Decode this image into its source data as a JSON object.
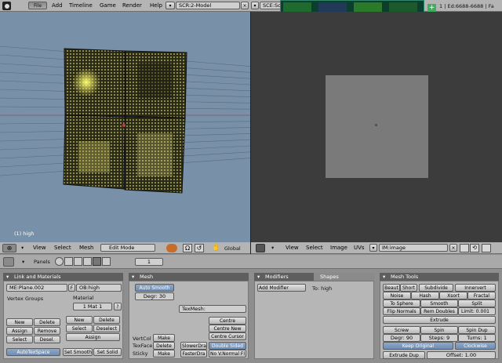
{
  "info_header": {
    "menu": [
      "File",
      "Add",
      "Timeline",
      "Game",
      "Render",
      "Help"
    ],
    "screen": "SCR:2-Model",
    "scene": "SCE:Sc",
    "stats": "1 | Ed:6688-6688 | Fa"
  },
  "viewport3d": {
    "status": "(1) high",
    "header": {
      "view": "View",
      "select": "Select",
      "mesh": "Mesh",
      "mode": "Edit Mode",
      "orientation": "Global"
    }
  },
  "uv_editor": {
    "header": {
      "view": "View",
      "select": "Select",
      "image": "Image",
      "uvs": "UVs",
      "image_name": "IM:image"
    }
  },
  "buttons_header": {
    "panels": "Panels",
    "frame": "1"
  },
  "link_materials": {
    "title": "Link and Materials",
    "mesh_name": "ME:Plane.002",
    "f": "F",
    "ob_name": "OB:high",
    "vertex_groups": "Vertex Groups",
    "material": "Material",
    "mat_slot": "1 Mat 1",
    "question": "?",
    "vg_buttons": [
      "New",
      "Delete",
      "Assign",
      "Remove",
      "Select",
      "Desel."
    ],
    "mat_buttons": [
      "New",
      "Delete",
      "Select",
      "Deselect",
      "Assign"
    ],
    "autotexspace": "AutoTexSpace",
    "set_smooth": "Set Smooth",
    "set_solid": "Set Solid"
  },
  "mesh_panel": {
    "title": "Mesh",
    "auto_smooth": "Auto Smooth",
    "degr": "Degr: 30",
    "texmesh": "TexMesh:",
    "centre": "Centre",
    "centre_new": "Centre New",
    "centre_cursor": "Centre Cursor",
    "vertcol": "VertCol",
    "texface": "TexFace",
    "sticky": "Sticky",
    "make1": "Make",
    "delete": "Delete",
    "make2": "Make",
    "slower": "SlowerDra",
    "faster": "FasterDra",
    "double_sided": "Double Sided",
    "no_v_normal": "No V.Normal Fl"
  },
  "modifiers_panel": {
    "tab1": "Modifiers",
    "tab2": "Shapes",
    "add_modifier": "Add Modifier",
    "to": "To: high"
  },
  "mesh_tools": {
    "title": "Mesh Tools",
    "row1": [
      "Beaut",
      "Short",
      "Subdivide",
      "Innervert"
    ],
    "row2": [
      "Noise",
      "Hash",
      "Xsort",
      "Fractal"
    ],
    "row3": [
      "To Sphere",
      "Smooth",
      "Split"
    ],
    "row4": [
      "Flip Normals",
      "Rem Doubles",
      "Limit: 0.001"
    ],
    "extrude": "Extrude",
    "row5": [
      "Screw",
      "Spin",
      "Spin Dup"
    ],
    "row6": [
      "Degr: 90",
      "Steps: 9",
      "Turns: 1"
    ],
    "keep_original": "Keep Original",
    "clockwise": "Clockwise",
    "extrude_dup": "Extrude Dup",
    "offset": "Offset: 1.00"
  },
  "colors": {
    "viewport_bg": "#7890a8",
    "uv_bg": "#3c3c3c",
    "image_fill": "#7a7a7a",
    "wire": "#e8e060"
  }
}
